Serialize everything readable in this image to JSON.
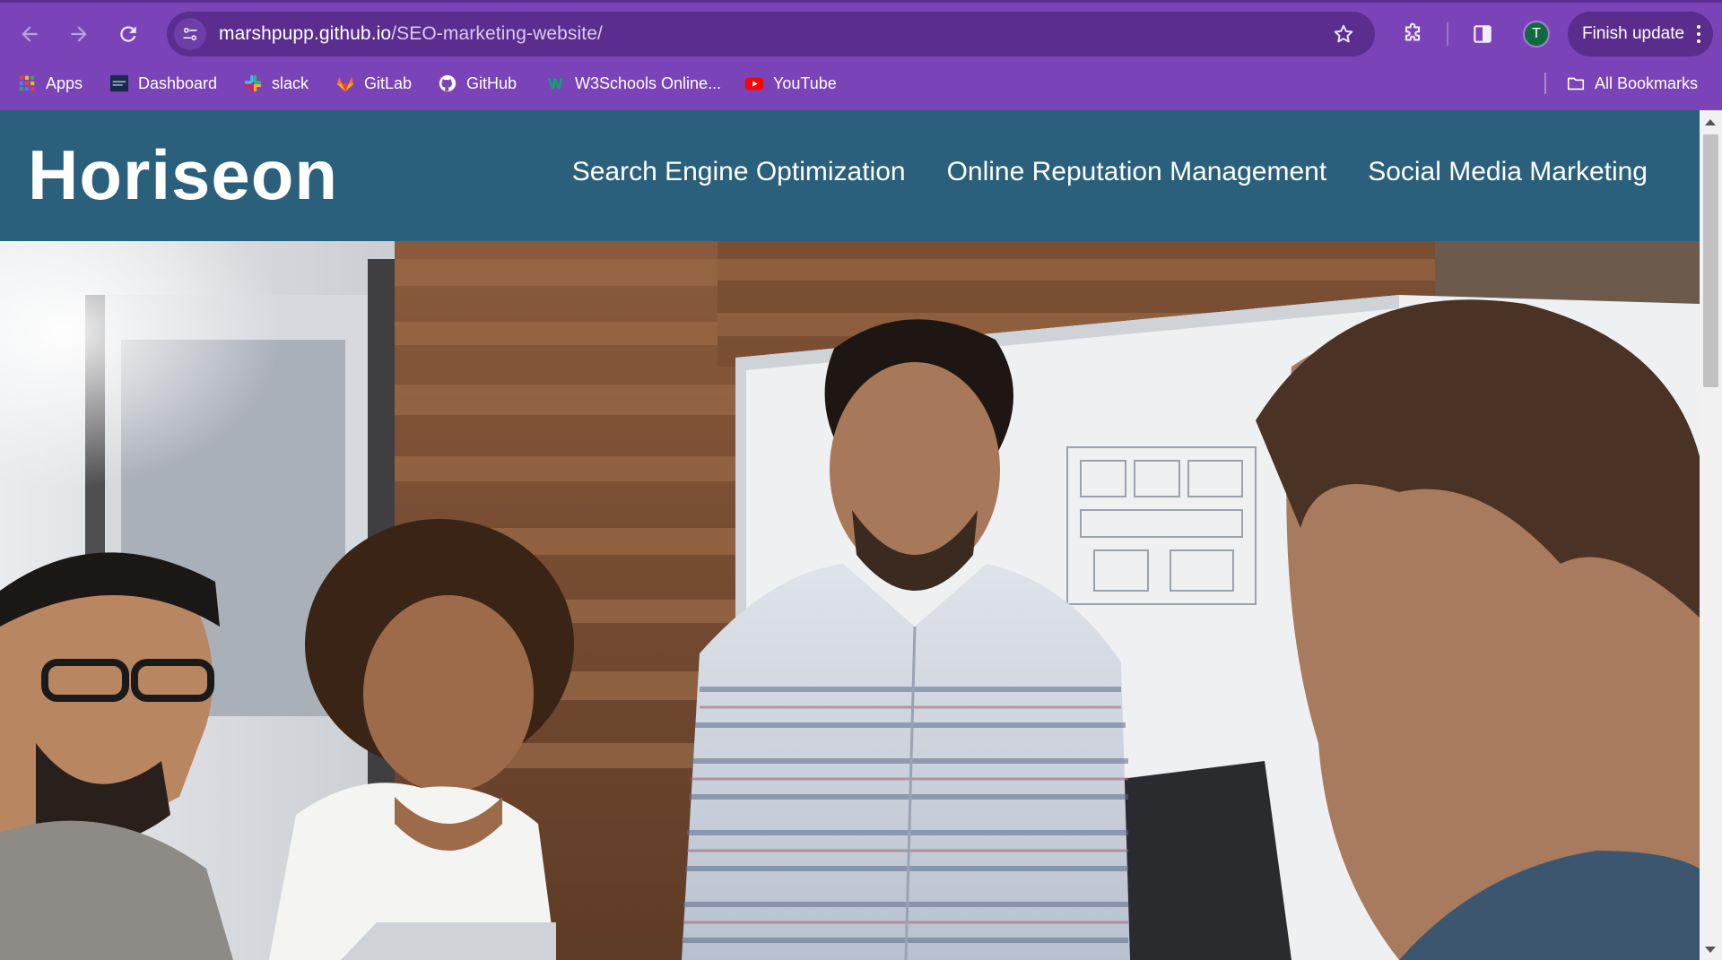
{
  "browser": {
    "url": {
      "domain": "marshpupp.github.io",
      "path": "/SEO-marketing-website/"
    },
    "update_button_label": "Finish update",
    "avatar_initial": "T",
    "accent_color": "#7a44b8",
    "bookmarks": [
      {
        "label": "Apps",
        "icon": "apps-grid-icon"
      },
      {
        "label": "Dashboard",
        "icon": "dashboard-icon"
      },
      {
        "label": "slack",
        "icon": "slack-icon"
      },
      {
        "label": "GitLab",
        "icon": "gitlab-icon"
      },
      {
        "label": "GitHub",
        "icon": "github-icon"
      },
      {
        "label": "W3Schools Online...",
        "icon": "w3schools-icon"
      },
      {
        "label": "YouTube",
        "icon": "youtube-icon"
      }
    ],
    "all_bookmarks_label": "All Bookmarks"
  },
  "site": {
    "logo": "Horiseon",
    "header_color": "#2a607c",
    "nav": [
      {
        "label": "Search Engine Optimization"
      },
      {
        "label": "Online Reputation Management"
      },
      {
        "label": "Social Media Marketing"
      }
    ],
    "hero_image": "team-meeting-photo"
  }
}
